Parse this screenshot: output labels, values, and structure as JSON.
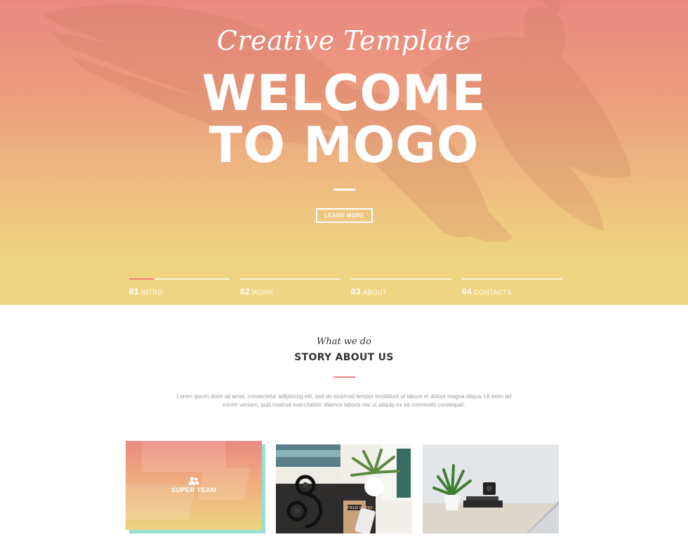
{
  "hero": {
    "subtitle": "Creative Template",
    "title_line1": "WELCOME",
    "title_line2": "TO MOGO",
    "cta_label": "LEARN MORE"
  },
  "slider": {
    "items": [
      {
        "num": "01",
        "label": "INTRO",
        "active": true
      },
      {
        "num": "02",
        "label": "WORK",
        "active": false
      },
      {
        "num": "03",
        "label": "ABOUT",
        "active": false
      },
      {
        "num": "04",
        "label": "CONTACTS",
        "active": false
      }
    ]
  },
  "about": {
    "kicker": "What we do",
    "title": "STORY ABOUT US",
    "text": "Lorem ipsum dolor sit amet, consectetur adipiscing elit, sed do eiusmod tempor incididunt ut labore et dolore magna aliqua. Ut enim ad minim veniam, quis nostrud exercitation ullamco laboris nisi ut aliquip ex ea commodo consequat."
  },
  "cards": {
    "team": {
      "label": "SUPER TEAM",
      "icon": "team-icon"
    },
    "photo2": {
      "icon": "workspace-photo",
      "notebook_text": "FIELD NOTES"
    },
    "photo3": {
      "icon": "desk-photo"
    }
  },
  "colors": {
    "accent": "#f38181",
    "hero_top": "#ea8880",
    "hero_bottom": "#efd683",
    "card_shadow": "#95e1d3"
  }
}
